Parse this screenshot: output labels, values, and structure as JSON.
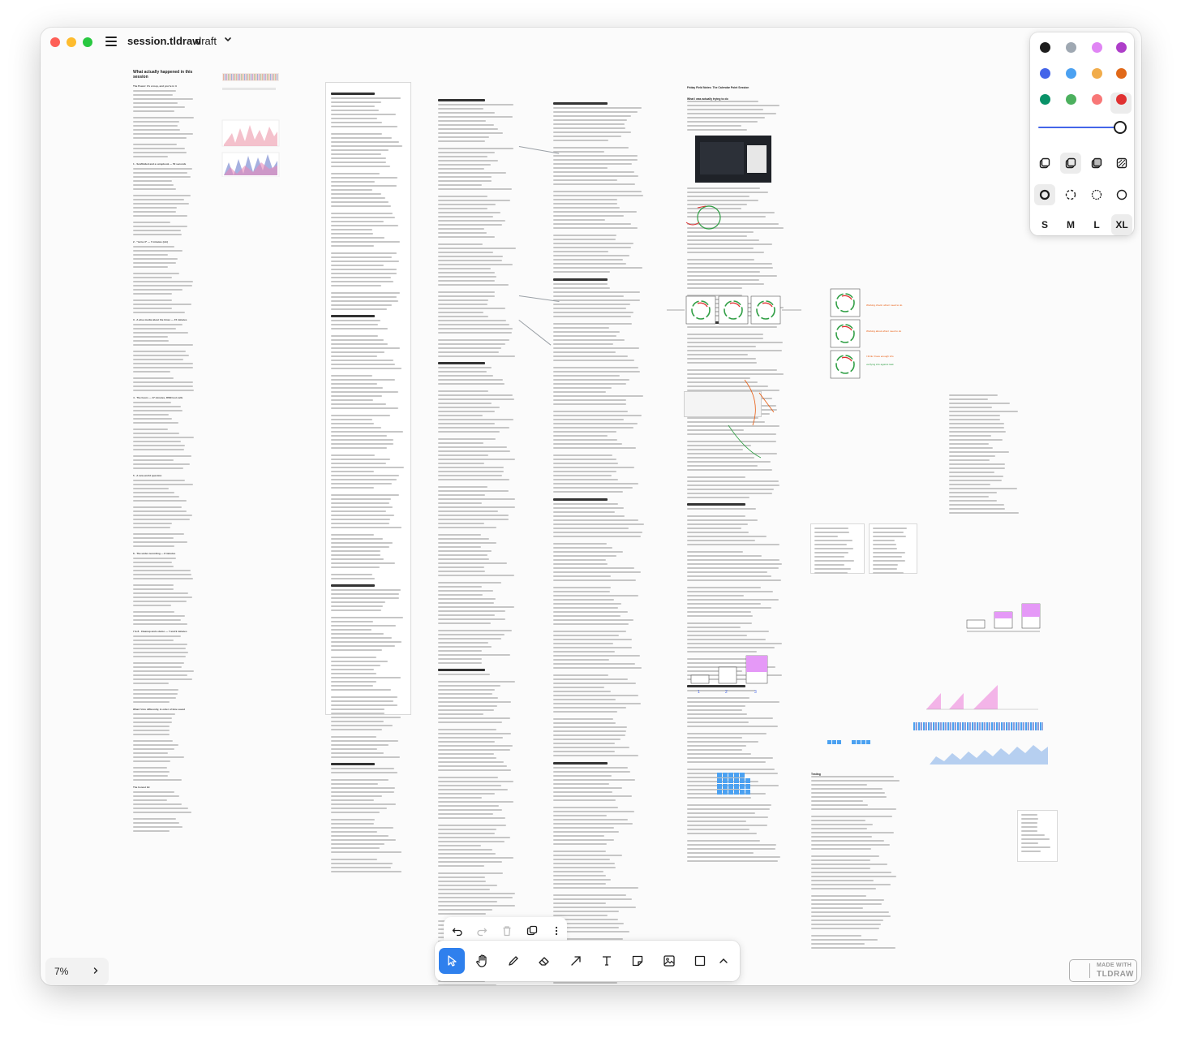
{
  "window": {
    "document_name": "session.tldraw",
    "page_name": "draft"
  },
  "canvas": {
    "col1_heading": "What actually happened in this session",
    "col1_sections": [
      "The Power: It's a loop, and you're in it",
      "1 - Scaffolded and a scrapbook — 50 seconds",
      "2 - \"turns 3\" — 7 minutes (ish)",
      "3 - A wise media about the times — 15 minutes",
      "4 - The hours — 47 minutes, RSM tool calls",
      "5 - A new-world question",
      "6 - The under-recording — 8 minutes",
      "7 & 8 - Cleanup and a demo — 7 and 9 minutes",
      "What I'd do differently, in order of time saved",
      "The honest bit"
    ],
    "right_doc_title": "Friday Field Notes: The Calendar Point Session",
    "right_doc_subtitle": "What I was actually trying to do",
    "right_doc_section": "\"Switch\"",
    "right_doc_bottom": "Testing",
    "sticky_labels": [
      "Working check: what I need to do",
      "Working about what I need to do",
      "I think I have enough info",
      "verifying info against task"
    ]
  },
  "style_panel": {
    "colors": [
      "#1d1d1d",
      "#9fa8b2",
      "#e085f4",
      "#ae3ec9",
      "#4465e9",
      "#4ba1f1",
      "#f1ac4b",
      "#e16919",
      "#099268",
      "#4cb05e",
      "#f87777",
      "#e03131"
    ],
    "selected_color": "#e03131",
    "opacity_percent": 100,
    "fill_options": [
      "fill-none-icon",
      "fill-semi-icon",
      "fill-solid-icon",
      "fill-pattern-icon"
    ],
    "dash_options": [
      "dash-draw-icon",
      "dash-dashed-icon",
      "dash-dotted-icon",
      "dash-solid-icon"
    ],
    "sizes": [
      "S",
      "M",
      "L",
      "XL"
    ],
    "selected_size": "XL"
  },
  "toolbar": {
    "tools": [
      "select-tool",
      "hand-tool",
      "draw-tool",
      "eraser-tool",
      "arrow-tool",
      "text-tool",
      "note-tool",
      "asset-tool",
      "rectangle-tool",
      "more-tools"
    ],
    "active_tool": "select-tool",
    "actions": [
      "undo",
      "redo",
      "delete",
      "duplicate",
      "more-actions"
    ]
  },
  "zoom": {
    "label": "7%"
  },
  "watermark": {
    "line1": "MADE WITH",
    "line2": "TLDRAW"
  }
}
